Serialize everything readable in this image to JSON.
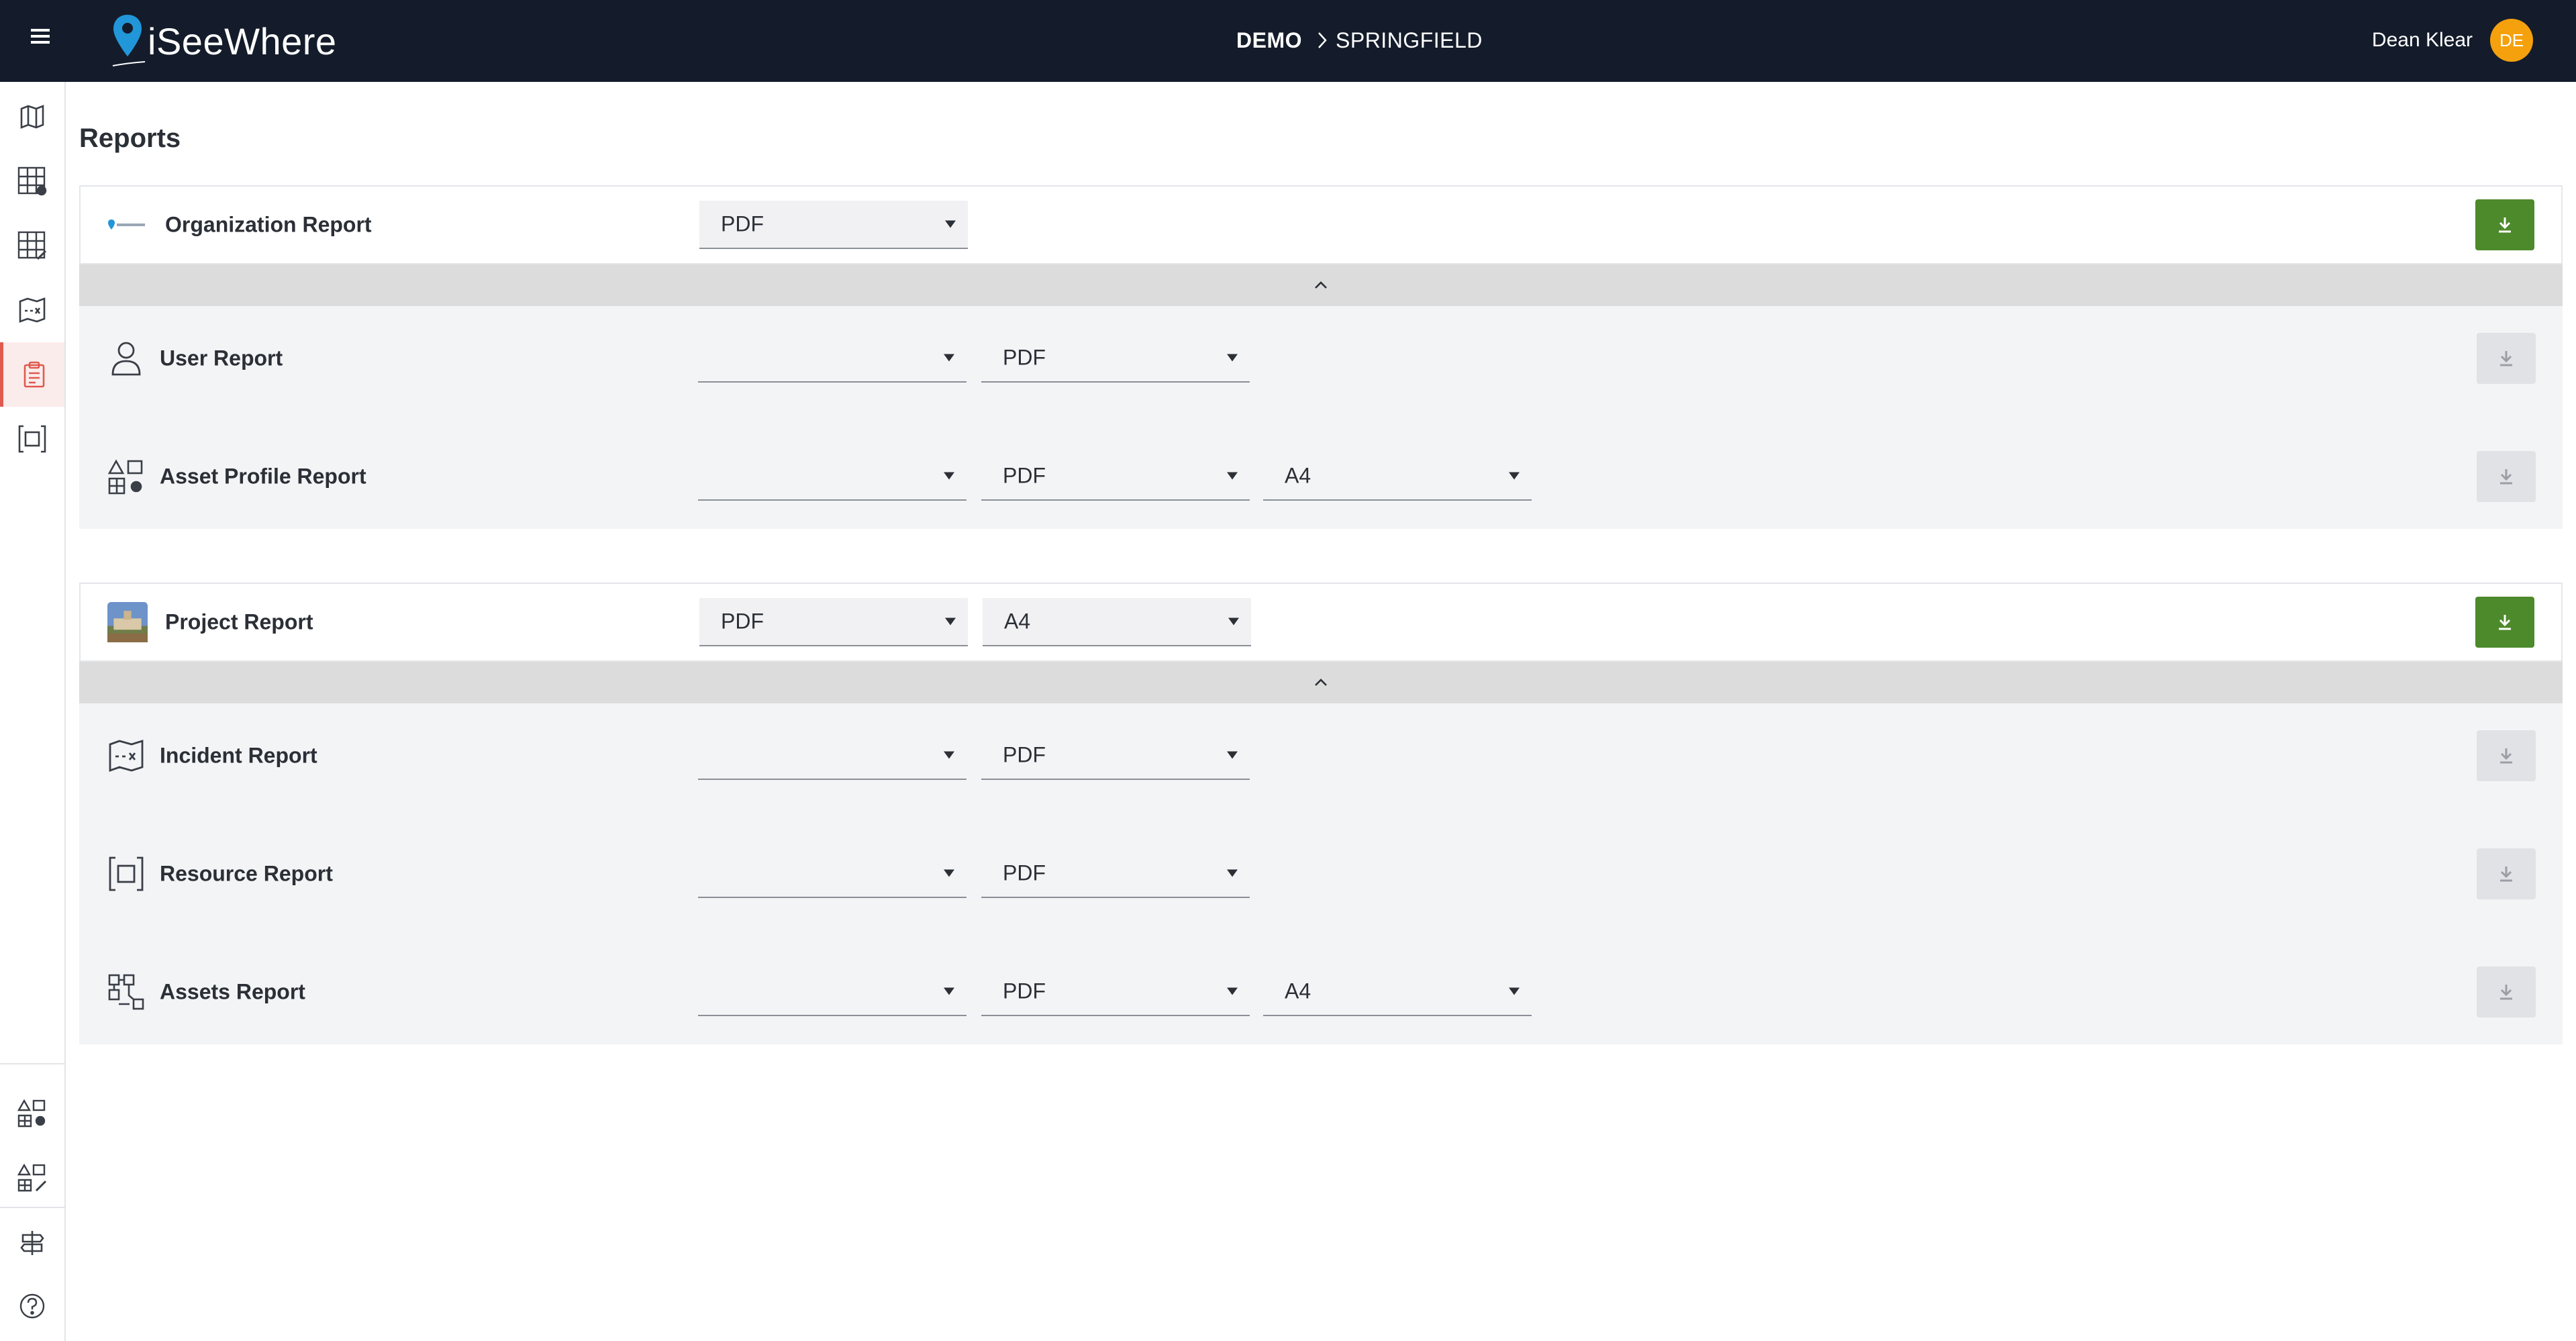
{
  "header": {
    "logo_text": "iSeeWhere",
    "breadcrumb": [
      "DEMO",
      "SPRINGFIELD"
    ],
    "user_name": "Dean Klear",
    "user_initials": "DE"
  },
  "sidebar": {
    "items": [
      {
        "name": "map-icon"
      },
      {
        "name": "asset-grid-icon"
      },
      {
        "name": "asset-grid-edit-icon"
      },
      {
        "name": "incident-map-icon"
      },
      {
        "name": "clipboard-icon",
        "active": true
      },
      {
        "name": "resource-frame-icon"
      },
      {
        "name": "shapes-grid-icon"
      },
      {
        "name": "shapes-grid-edit-icon"
      },
      {
        "name": "signpost-icon"
      },
      {
        "name": "help-icon"
      }
    ]
  },
  "page": {
    "title": "Reports"
  },
  "groups": [
    {
      "title": "Organization Report",
      "icon": "isee-logo-icon",
      "selects": [
        "PDF"
      ],
      "download_enabled": true,
      "children": [
        {
          "label": "User Report",
          "icon": "user-icon",
          "selects": [
            "",
            "PDF"
          ]
        },
        {
          "label": "Asset Profile Report",
          "icon": "asset-profile-icon",
          "selects": [
            "",
            "PDF",
            "A4"
          ]
        }
      ]
    },
    {
      "title": "Project Report",
      "icon": "project-photo-icon",
      "selects": [
        "PDF",
        "A4"
      ],
      "download_enabled": true,
      "children": [
        {
          "label": "Incident Report",
          "icon": "incident-map-icon",
          "selects": [
            "",
            "PDF"
          ]
        },
        {
          "label": "Resource Report",
          "icon": "resource-frame-icon",
          "selects": [
            "",
            "PDF"
          ]
        },
        {
          "label": "Assets Report",
          "icon": "assets-grid-icon",
          "selects": [
            "",
            "PDF",
            "A4"
          ]
        }
      ]
    }
  ],
  "colors": {
    "header_bg": "#141c2b",
    "accent_green": "#4c8a2b",
    "avatar_orange": "#f5a10d",
    "active_nav": "#e05a4f",
    "pin_blue": "#2196d9"
  }
}
